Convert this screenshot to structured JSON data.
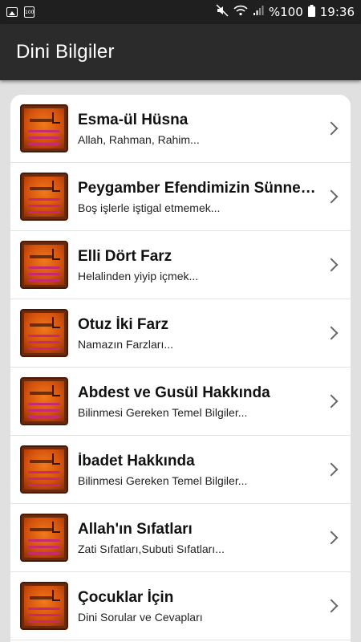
{
  "status_bar": {
    "battery": "%100",
    "time": "19:36",
    "cal_label": "100"
  },
  "app_bar": {
    "title": "Dini Bilgiler"
  },
  "items": [
    {
      "title": "Esma-ül Hüsna",
      "subtitle": "Allah, Rahman, Rahim..."
    },
    {
      "title": "Peygamber Efendimizin Sünnetleri",
      "subtitle": "Boş işlerle iştigal etmemek..."
    },
    {
      "title": "Elli Dört Farz",
      "subtitle": "Helalinden yiyip içmek..."
    },
    {
      "title": "Otuz İki Farz",
      "subtitle": "Namazın Farzları..."
    },
    {
      "title": "Abdest ve Gusül Hakkında",
      "subtitle": "Bilinmesi Gereken Temel Bilgiler..."
    },
    {
      "title": "İbadet Hakkında",
      "subtitle": "Bilinmesi Gereken Temel Bilgiler..."
    },
    {
      "title": "Allah'ın Sıfatları",
      "subtitle": "Zati Sıfatları,Subuti Sıfatları..."
    },
    {
      "title": "Çocuklar İçin",
      "subtitle": "Dini Sorular ve Cevapları"
    }
  ]
}
